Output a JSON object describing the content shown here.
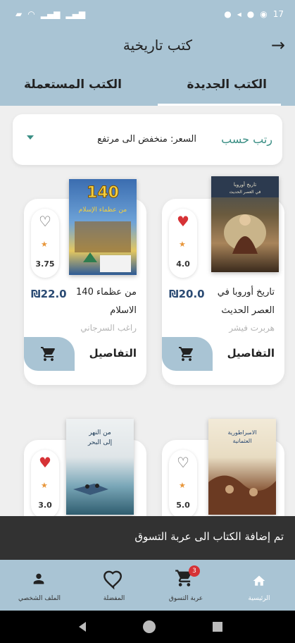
{
  "status_bar": {
    "left_text": "•",
    "right_text": "17"
  },
  "appbar": {
    "title": "كتب تاريخية",
    "back_icon": "arrow-right-icon"
  },
  "tabs": [
    {
      "label": "الكتب الجديدة",
      "active": true
    },
    {
      "label": "الكتب المستعملة",
      "active": false
    }
  ],
  "sort": {
    "label": "رتب حسب",
    "value": "السعر: منخفض الى مرتفع"
  },
  "books": [
    {
      "title": "تاريخ أوروبا في العصر الحديث",
      "author": "هربرت فيشر",
      "price": "₪20.0",
      "rating": "4.0",
      "favorite": true,
      "details_label": "التفاصيل",
      "cover_title": "تاريخ أوروبا في العصر الحديث"
    },
    {
      "title": "140 من عظماء الاسلام",
      "author": "راغب السرجاني",
      "price": "₪22.0",
      "rating": "3.75",
      "favorite": false,
      "details_label": "التفاصيل",
      "cover_title": "140 من عظماء الاسلام"
    },
    {
      "title": "",
      "author": "",
      "price": "",
      "rating": "5.0",
      "favorite": false,
      "details_label": "",
      "cover_title": "الامبراطورية العثمانية"
    },
    {
      "title": "",
      "author": "",
      "price": "",
      "rating": "3.0",
      "favorite": true,
      "details_label": "",
      "cover_title": "من النهر إلى البحر"
    }
  ],
  "snackbar": {
    "message": "تم إضافة الكتاب الى عربة التسوق"
  },
  "bottom_nav": [
    {
      "label": "الرئيسية",
      "icon": "home-icon",
      "active": true
    },
    {
      "label": "عربة التسوق",
      "icon": "cart-icon",
      "badge": "3",
      "active": false
    },
    {
      "label": "المفضلة",
      "icon": "heart-icon",
      "active": false
    },
    {
      "label": "الملف الشخصي",
      "icon": "person-icon",
      "active": false
    }
  ],
  "colors": {
    "primary": "#a9c4d4",
    "accent": "#3b8f85",
    "heart": "#d63236",
    "price": "#2a4a73",
    "star": "#e8963a"
  }
}
